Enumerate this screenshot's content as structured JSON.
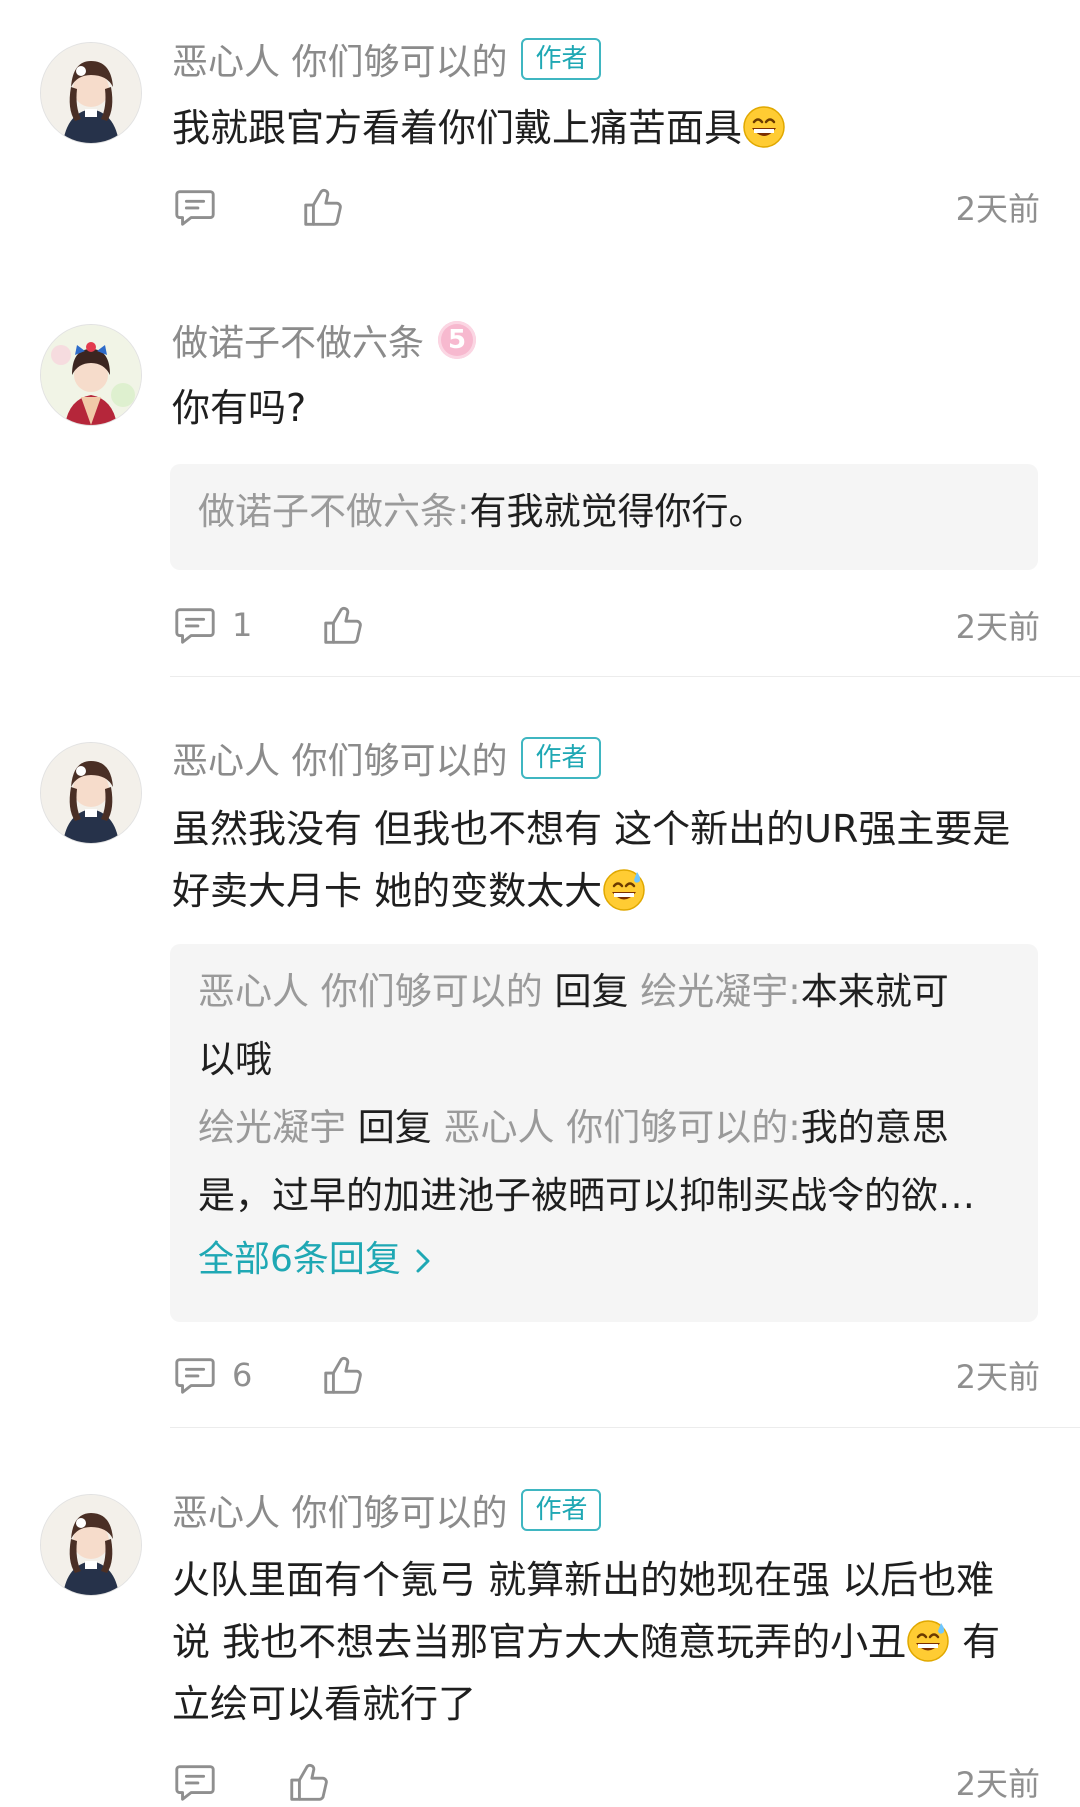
{
  "comments": [
    {
      "user": "恶心人 你们够可以的",
      "badge": "作者",
      "text": "我就跟官方看着你们戴上痛苦面具",
      "reply_count": "",
      "time": "2天前"
    },
    {
      "user": "做诺子不做六条",
      "level": "5",
      "text": "你有吗?",
      "replies": [
        {
          "from": "做诺子不做六条",
          "sep": ":",
          "text": "有我就觉得你行。"
        }
      ],
      "reply_count": "1",
      "time": "2天前"
    },
    {
      "user": "恶心人 你们够可以的",
      "badge": "作者",
      "text_line1": "虽然我没有 但我也不想有 这个新出的UR强主要是",
      "text_line2": "好卖大月卡 她的变数太大",
      "replies": [
        {
          "from": "恶心人 你们够可以的",
          "verb": "回复",
          "to": "绘光凝宇",
          "sep": ":",
          "text_a": "本来就可",
          "text_b": "以哦"
        },
        {
          "from": "绘光凝宇",
          "verb": "回复",
          "to": "恶心人 你们够可以的",
          "sep": ":",
          "text_a": "我的意思",
          "text_b": "是，过早的加进池子被晒可以抑制买战令的欲…"
        }
      ],
      "more_label": "全部6条回复",
      "reply_count": "6",
      "time": "2天前"
    },
    {
      "user": "恶心人 你们够可以的",
      "badge": "作者",
      "text_line1": "火队里面有个氪弓  就算新出的她现在强 以后也难",
      "text_line2a": "说 我也不想去当那官方大大随意玩弄的小丑",
      "text_line2b": " 有",
      "text_line3": "立绘可以看就行了",
      "time": "2天前"
    }
  ],
  "icons": {
    "comment": "comment-icon",
    "like": "thumbs-up-icon",
    "emoji_grin": "grinning-emoji-icon",
    "emoji_sweat": "sweat-smile-emoji-icon",
    "chevron": "chevron-right-icon"
  },
  "colors": {
    "accent": "#1fa8b4",
    "muted": "#8b8b8b",
    "reply_bg": "#f5f5f5",
    "level_badge": "#f7b9cf"
  }
}
